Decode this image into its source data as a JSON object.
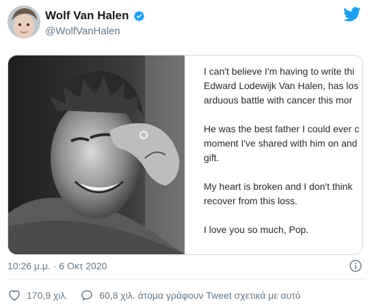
{
  "author": {
    "display_name": "Wolf Van Halen",
    "handle": "@WolfVanHalen",
    "verified": true
  },
  "statement": {
    "lines": [
      "I can't believe I'm having to write thi",
      "Edward Lodewijk Van Halen, has los",
      "arduous battle with cancer this mor",
      "He was the best father I could ever c",
      "moment I've shared with him on and",
      "gift.",
      "My heart is broken and I don't think",
      "recover from this loss.",
      "I love you so much, Pop."
    ]
  },
  "meta": {
    "timestamp": "10:26 μ.μ. · 6 Οκτ 2020"
  },
  "stats": {
    "likes": "170,9 χιλ.",
    "talking": "60,8 χιλ. άτομα γράφουν Tweet σχετικά με αυτό"
  },
  "colors": {
    "accent": "#1da1f2",
    "text_secondary": "#657786",
    "heart_icon": "#e0245e"
  },
  "icons": {
    "verified": "verified-badge-icon",
    "brand": "twitter-bird-icon",
    "info": "info-icon",
    "like": "heart-icon",
    "reply": "speech-bubble-icon"
  }
}
